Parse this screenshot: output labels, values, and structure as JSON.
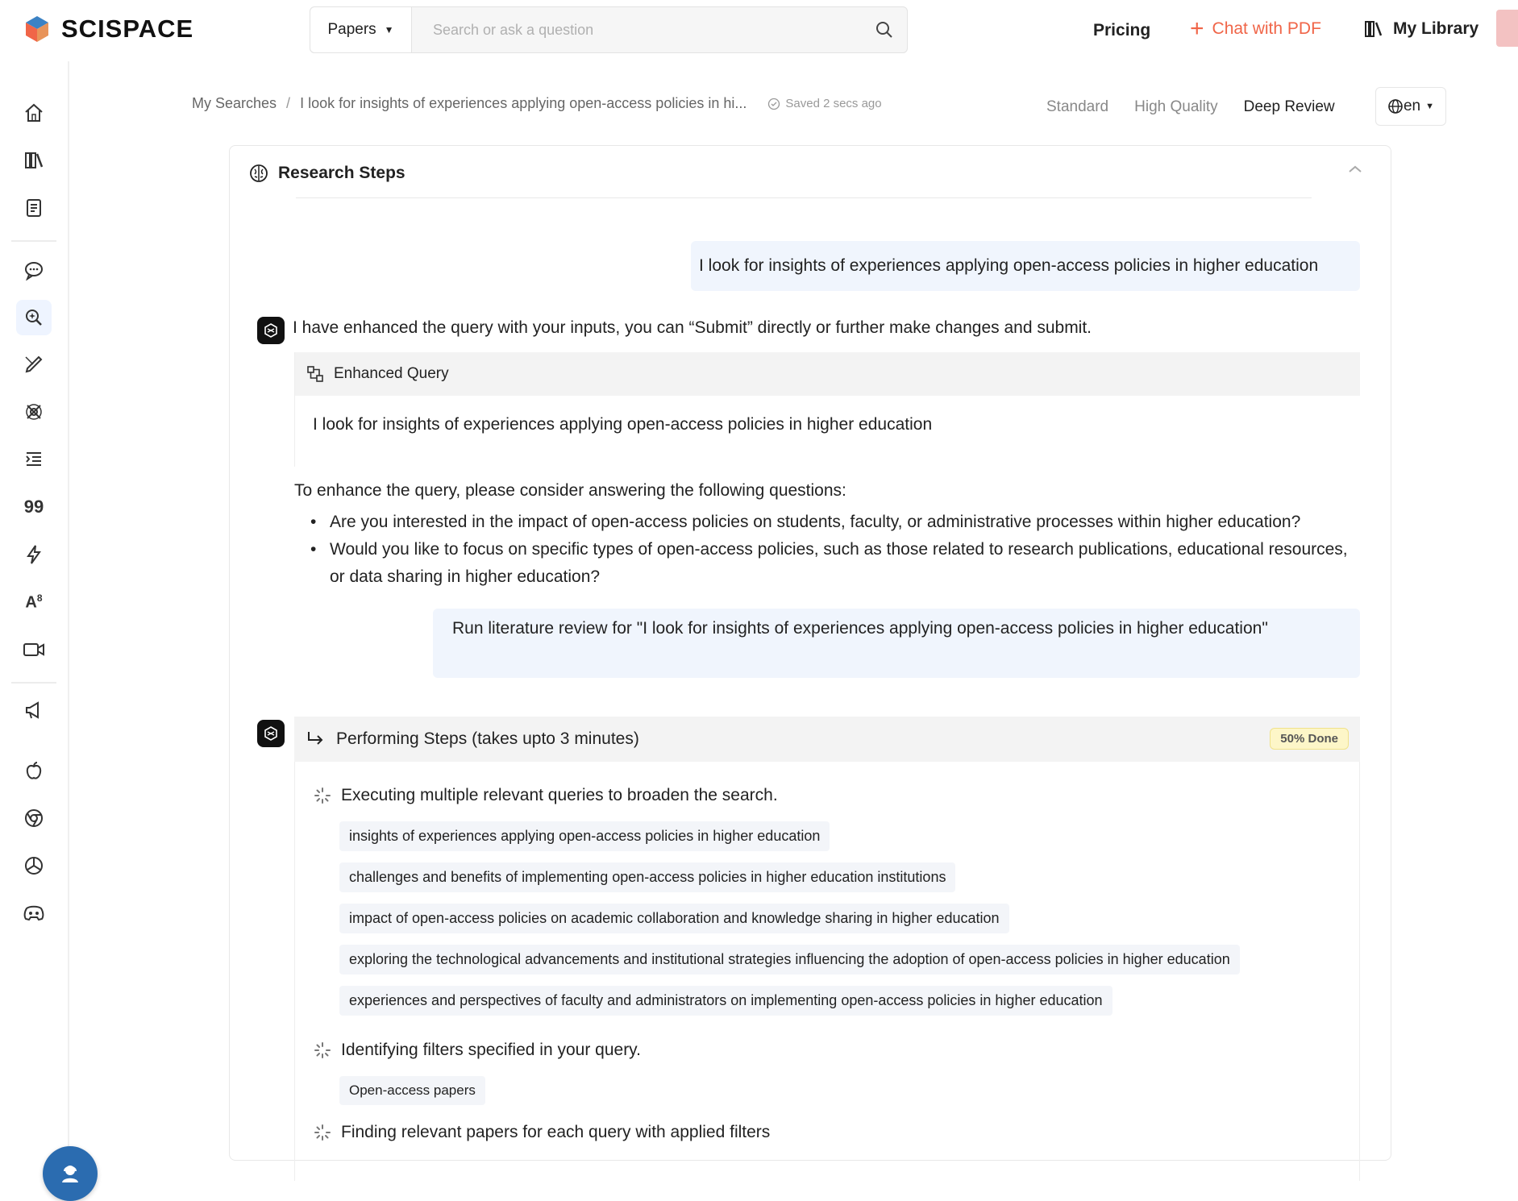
{
  "brand": {
    "name": "SCISPACE"
  },
  "search": {
    "type_label": "Papers",
    "placeholder": "Search or ask a question"
  },
  "nav": {
    "pricing": "Pricing",
    "chat": "Chat with PDF",
    "library": "My Library"
  },
  "breadcrumb": {
    "root": "My Searches",
    "separator": "/",
    "current": "I look for insights of experiences applying open-access policies in hi...",
    "saved": "Saved 2 secs ago"
  },
  "modes": {
    "standard": "Standard",
    "high_quality": "High Quality",
    "deep_review": "Deep Review",
    "active": "Deep Review"
  },
  "language": {
    "value": "en"
  },
  "panel": {
    "title": "Research Steps",
    "user_query": "I look for insights of experiences applying open-access policies in higher education",
    "bot_message": "I have enhanced the query with your inputs, you can “Submit” directly or further make changes and submit.",
    "enhanced_label": "Enhanced Query",
    "enhanced_query": "I look for insights of experiences applying open-access policies in higher education",
    "questions_intro": "To enhance the query, please consider answering the following questions:",
    "questions": [
      "Are you interested in the impact of open-access policies on students, faculty, or administrative processes within higher education?",
      "Would you like to focus on specific types of open-access policies, such as those related to research publications, educational resources, or data sharing in higher education?"
    ],
    "run_review": "Run literature review for \"I look for insights of experiences applying open-access policies in higher education\"",
    "steps_title": "Performing Steps (takes upto 3 minutes)",
    "progress": "50% Done",
    "step1": "Executing multiple relevant queries to broaden the search.",
    "queries": [
      "insights of experiences applying open-access policies in higher education",
      "challenges and benefits of implementing open-access policies in higher education institutions",
      "impact of open-access policies on academic collaboration and knowledge sharing in higher education",
      "exploring the technological advancements and institutional strategies influencing the adoption of open-access policies in higher education",
      "experiences and perspectives of faculty and administrators on implementing open-access policies in higher education"
    ],
    "step2": "Identifying filters specified in your query.",
    "filter": "Open-access papers",
    "step3": "Finding relevant papers for each query with applied filters"
  },
  "colors": {
    "accent": "#f06548",
    "user_bubble": "#f0f5fd",
    "badge": "#fdf6c8",
    "support": "#2b6cb0"
  },
  "sidebar_icons": [
    "home-icon",
    "library-icon",
    "notebook-icon",
    "chat-icon",
    "literature-review-icon",
    "writer-icon",
    "extension-icon",
    "outline-icon",
    "citation-icon",
    "paraphraser-icon",
    "ai-detector-icon",
    "video-icon",
    "announcement-icon",
    "apple-icon",
    "chrome-icon",
    "openai-icon",
    "discord-icon"
  ]
}
